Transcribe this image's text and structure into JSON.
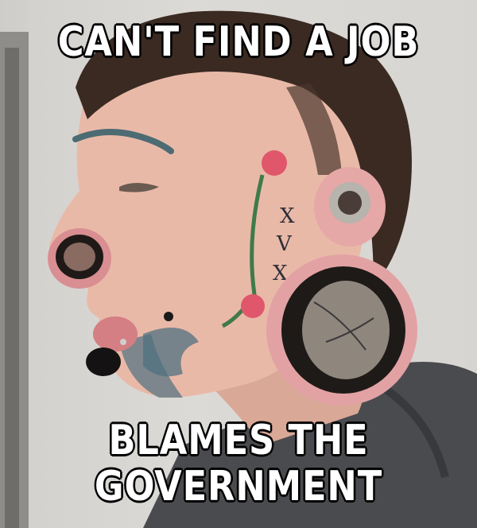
{
  "meme": {
    "top_text": "CAN'T FIND A JOB",
    "bottom_line_1": "BLAMES THE",
    "bottom_line_2": "GOVERNMENT"
  },
  "face_tattoo": {
    "letters": [
      "X",
      "V",
      "X"
    ]
  },
  "colors": {
    "caption_fill": "#ffffff",
    "caption_stroke": "#000000",
    "hoodie": "#4a4b4e",
    "skin": "#e9b9a8"
  }
}
